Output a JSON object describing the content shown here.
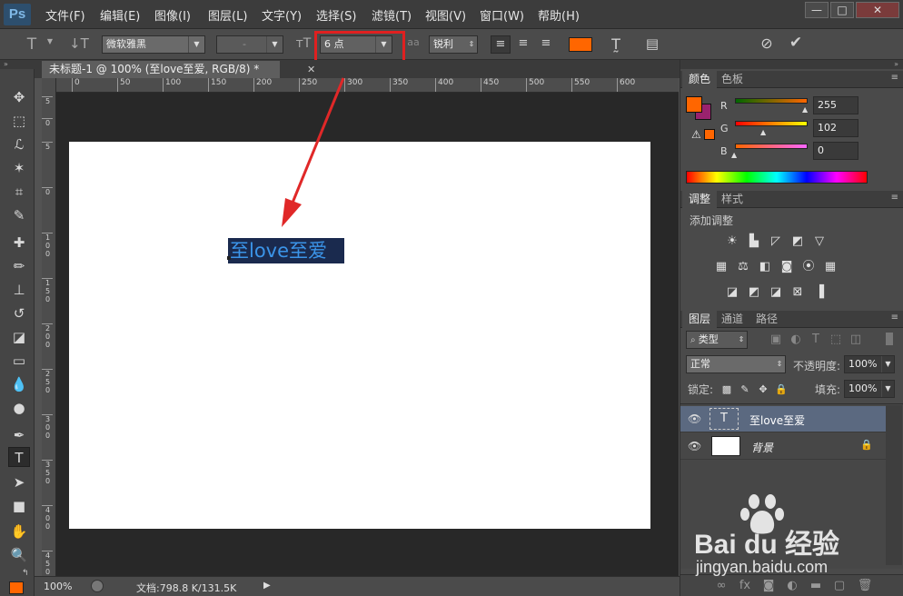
{
  "app": {
    "logo": "Ps"
  },
  "menu": [
    "文件(F)",
    "编辑(E)",
    "图像(I)",
    "图层(L)",
    "文字(Y)",
    "选择(S)",
    "滤镜(T)",
    "视图(V)",
    "窗口(W)",
    "帮助(H)"
  ],
  "window_controls": {
    "minimize": "—",
    "maximize": "□",
    "close": "✕"
  },
  "options": {
    "font_family": "微软雅黑",
    "font_style": "-",
    "font_size": "6 点",
    "antialias_icon": "aa",
    "antialias": "锐利",
    "text_color": "#ff6600"
  },
  "document": {
    "tab_title": "未标题-1 @ 100% (至love至爱, RGB/8) *",
    "close": "✕",
    "text": "至love至爱"
  },
  "ruler": {
    "h_labels": [
      "0",
      "50",
      "100",
      "150",
      "200",
      "250",
      "300",
      "350",
      "400",
      "450",
      "500",
      "550",
      "600"
    ],
    "v_labels": [
      "5",
      "0",
      "5",
      "0",
      "1 0 0",
      "1 5 0",
      "2 0 0",
      "2 5 0",
      "3 0 0",
      "3 5 0",
      "4 0 0",
      "4 5 0"
    ]
  },
  "status": {
    "zoom": "100%",
    "doc_info": "文档:798.8 K/131.5K",
    "arrow": "▶"
  },
  "colors_panel": {
    "tabs": [
      "颜色",
      "色板"
    ],
    "fg": "#ff6600",
    "bg": "#99226e",
    "r_label": "R",
    "r_value": "255",
    "g_label": "G",
    "g_value": "102",
    "b_label": "B",
    "b_value": "0"
  },
  "adjust_panel": {
    "tabs": [
      "调整",
      "样式"
    ],
    "title": "添加调整"
  },
  "layers_panel": {
    "tabs": [
      "图层",
      "通道",
      "路径"
    ],
    "filter_label": "类型",
    "blend_mode": "正常",
    "opacity_label": "不透明度:",
    "opacity_value": "100%",
    "lock_label": "锁定:",
    "fill_label": "填充:",
    "fill_value": "100%",
    "layers": [
      {
        "name": "至love至爱",
        "thumb": "T"
      },
      {
        "name": "背景",
        "thumb": ""
      }
    ]
  },
  "watermark": {
    "brand": "Bai du 经验",
    "url": "jingyan.baidu.com"
  }
}
